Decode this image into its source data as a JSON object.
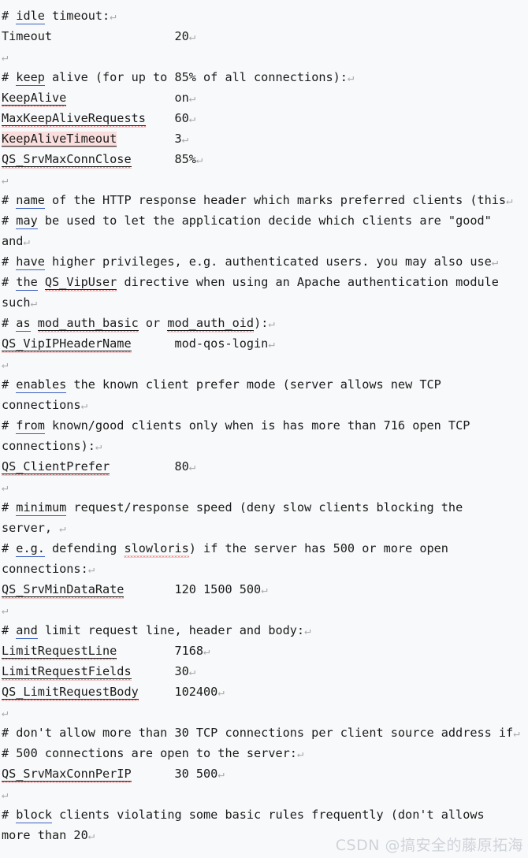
{
  "document": {
    "background_color": "#f8f9fa",
    "text_color": "#1b1b1b",
    "link_underline_color": "#3c5fbf",
    "spellcheck_squiggle_color": "#e03131",
    "highlight_color": "#f9dedd",
    "cr_mark_color": "#a6a9ad",
    "cr_mark": "↵"
  },
  "watermark": {
    "text": "CSDN @搞安全的藤原拓海"
  },
  "lines": [
    {
      "id": "l00",
      "type": "blank-clipped",
      "segments": [
        {
          "t": "cr",
          "text": "↵"
        }
      ]
    },
    {
      "id": "l01",
      "type": "comment",
      "segments": [
        {
          "t": "plain",
          "text": "# "
        },
        {
          "t": "kw",
          "text": "idle"
        },
        {
          "t": "plain",
          "text": " timeout:"
        },
        {
          "t": "cr",
          "text": "↵"
        }
      ]
    },
    {
      "id": "l02",
      "type": "directive",
      "segments": [
        {
          "t": "plain",
          "text": "Timeout"
        },
        {
          "t": "plain",
          "text": "                 20"
        },
        {
          "t": "cr",
          "text": "↵"
        }
      ]
    },
    {
      "id": "l03",
      "type": "blank",
      "segments": [
        {
          "t": "cr",
          "text": "↵"
        }
      ]
    },
    {
      "id": "l04",
      "type": "comment",
      "segments": [
        {
          "t": "plain",
          "text": "# "
        },
        {
          "t": "kw",
          "text": "keep"
        },
        {
          "t": "plain",
          "text": " alive (for up to 85% of all connections):"
        },
        {
          "t": "cr",
          "text": "↵"
        }
      ]
    },
    {
      "id": "l05",
      "type": "directive",
      "segments": [
        {
          "t": "sq",
          "text": "KeepAlive"
        },
        {
          "t": "plain",
          "text": "               on"
        },
        {
          "t": "cr",
          "text": "↵"
        }
      ]
    },
    {
      "id": "l06",
      "type": "directive",
      "segments": [
        {
          "t": "sq",
          "text": "MaxKeepAliveRequests"
        },
        {
          "t": "plain",
          "text": "    60"
        },
        {
          "t": "cr",
          "text": "↵"
        }
      ]
    },
    {
      "id": "l07",
      "type": "directive",
      "segments": [
        {
          "t": "sq-hl",
          "text": "KeepAliveTimeout"
        },
        {
          "t": "plain",
          "text": "        3"
        },
        {
          "t": "cr",
          "text": "↵"
        }
      ]
    },
    {
      "id": "l08",
      "type": "directive",
      "segments": [
        {
          "t": "sq",
          "text": "QS_SrvMaxConnClose"
        },
        {
          "t": "plain",
          "text": "      85%"
        },
        {
          "t": "cr",
          "text": "↵"
        }
      ]
    },
    {
      "id": "l09",
      "type": "blank",
      "segments": [
        {
          "t": "cr",
          "text": "↵"
        }
      ]
    },
    {
      "id": "l10",
      "type": "comment",
      "segments": [
        {
          "t": "plain",
          "text": "# "
        },
        {
          "t": "kw",
          "text": "name"
        },
        {
          "t": "plain",
          "text": " of the HTTP response header which marks preferred clients (this"
        },
        {
          "t": "cr",
          "text": "↵"
        }
      ]
    },
    {
      "id": "l11",
      "type": "comment",
      "segments": [
        {
          "t": "plain",
          "text": "# "
        },
        {
          "t": "kw",
          "text": "may"
        },
        {
          "t": "plain",
          "text": " be used to let the application decide which clients are \"good\""
        }
      ]
    },
    {
      "id": "l12",
      "type": "comment-wrap",
      "segments": [
        {
          "t": "plain",
          "text": "and"
        },
        {
          "t": "cr",
          "text": "↵"
        }
      ]
    },
    {
      "id": "l13",
      "type": "comment",
      "segments": [
        {
          "t": "plain",
          "text": "# "
        },
        {
          "t": "kw",
          "text": "have"
        },
        {
          "t": "plain",
          "text": " higher privileges, e.g. authenticated users. you may also use"
        },
        {
          "t": "cr",
          "text": "↵"
        }
      ]
    },
    {
      "id": "l14",
      "type": "comment",
      "segments": [
        {
          "t": "plain",
          "text": "# "
        },
        {
          "t": "kw",
          "text": "the"
        },
        {
          "t": "plain",
          "text": " "
        },
        {
          "t": "sq",
          "text": "QS_VipUser"
        },
        {
          "t": "plain",
          "text": " directive when using an Apache authentication module"
        }
      ]
    },
    {
      "id": "l15",
      "type": "comment-wrap",
      "segments": [
        {
          "t": "plain",
          "text": "such"
        },
        {
          "t": "cr",
          "text": "↵"
        }
      ]
    },
    {
      "id": "l16",
      "type": "comment",
      "segments": [
        {
          "t": "plain",
          "text": "# "
        },
        {
          "t": "kw",
          "text": "as"
        },
        {
          "t": "plain",
          "text": " "
        },
        {
          "t": "sq",
          "text": "mod_auth_basic"
        },
        {
          "t": "plain",
          "text": " or "
        },
        {
          "t": "sq",
          "text": "mod_auth_oid"
        },
        {
          "t": "plain",
          "text": "):"
        },
        {
          "t": "cr",
          "text": "↵"
        }
      ]
    },
    {
      "id": "l17",
      "type": "directive",
      "segments": [
        {
          "t": "sq",
          "text": "QS_VipIPHeaderName"
        },
        {
          "t": "plain",
          "text": "      mod-qos-login"
        },
        {
          "t": "cr",
          "text": "↵"
        }
      ]
    },
    {
      "id": "l18",
      "type": "blank",
      "segments": [
        {
          "t": "cr",
          "text": "↵"
        }
      ]
    },
    {
      "id": "l19",
      "type": "comment",
      "segments": [
        {
          "t": "plain",
          "text": "# "
        },
        {
          "t": "kw",
          "text": "enables"
        },
        {
          "t": "plain",
          "text": " the known client prefer mode (server allows new TCP"
        }
      ]
    },
    {
      "id": "l20",
      "type": "comment-wrap",
      "segments": [
        {
          "t": "plain",
          "text": "connections"
        },
        {
          "t": "cr",
          "text": "↵"
        }
      ]
    },
    {
      "id": "l21",
      "type": "comment",
      "segments": [
        {
          "t": "plain",
          "text": "# "
        },
        {
          "t": "kw",
          "text": "from"
        },
        {
          "t": "plain",
          "text": " known/good clients only when is has more than 716 open TCP"
        }
      ]
    },
    {
      "id": "l22",
      "type": "comment-wrap",
      "segments": [
        {
          "t": "plain",
          "text": "connections):"
        },
        {
          "t": "cr",
          "text": "↵"
        }
      ]
    },
    {
      "id": "l23",
      "type": "directive",
      "segments": [
        {
          "t": "sq",
          "text": "QS_ClientPrefer"
        },
        {
          "t": "plain",
          "text": "         80"
        },
        {
          "t": "cr",
          "text": "↵"
        }
      ]
    },
    {
      "id": "l24",
      "type": "blank",
      "segments": [
        {
          "t": "cr",
          "text": "↵"
        }
      ]
    },
    {
      "id": "l25",
      "type": "comment",
      "segments": [
        {
          "t": "plain",
          "text": "# "
        },
        {
          "t": "kw",
          "text": "minimum"
        },
        {
          "t": "plain",
          "text": " request/response speed (deny slow clients blocking the"
        }
      ]
    },
    {
      "id": "l26",
      "type": "comment-wrap",
      "segments": [
        {
          "t": "plain",
          "text": "server, "
        },
        {
          "t": "cr",
          "text": "↵"
        }
      ]
    },
    {
      "id": "l27",
      "type": "comment",
      "segments": [
        {
          "t": "plain",
          "text": "# "
        },
        {
          "t": "kw",
          "text": "e.g."
        },
        {
          "t": "plain",
          "text": " defending "
        },
        {
          "t": "sq-plain",
          "text": "slowloris"
        },
        {
          "t": "plain",
          "text": ") if the server has 500 or more open"
        }
      ]
    },
    {
      "id": "l28",
      "type": "comment-wrap",
      "segments": [
        {
          "t": "plain",
          "text": "connections:"
        },
        {
          "t": "cr",
          "text": "↵"
        }
      ]
    },
    {
      "id": "l29",
      "type": "directive",
      "segments": [
        {
          "t": "sq",
          "text": "QS_SrvMinDataRate"
        },
        {
          "t": "plain",
          "text": "       120 1500 500"
        },
        {
          "t": "cr",
          "text": "↵"
        }
      ]
    },
    {
      "id": "l30",
      "type": "blank",
      "segments": [
        {
          "t": "cr",
          "text": "↵"
        }
      ]
    },
    {
      "id": "l31",
      "type": "comment",
      "segments": [
        {
          "t": "plain",
          "text": "# "
        },
        {
          "t": "kw",
          "text": "and"
        },
        {
          "t": "plain",
          "text": " limit request line, header and body:"
        },
        {
          "t": "cr",
          "text": "↵"
        }
      ]
    },
    {
      "id": "l32",
      "type": "directive",
      "segments": [
        {
          "t": "sq",
          "text": "LimitRequestLine"
        },
        {
          "t": "plain",
          "text": "        7168"
        },
        {
          "t": "cr",
          "text": "↵"
        }
      ]
    },
    {
      "id": "l33",
      "type": "directive",
      "segments": [
        {
          "t": "sq",
          "text": "LimitRequestFields"
        },
        {
          "t": "plain",
          "text": "      30"
        },
        {
          "t": "cr",
          "text": "↵"
        }
      ]
    },
    {
      "id": "l34",
      "type": "directive",
      "segments": [
        {
          "t": "sq",
          "text": "QS_LimitRequestBody"
        },
        {
          "t": "plain",
          "text": "     102400"
        },
        {
          "t": "cr",
          "text": "↵"
        }
      ]
    },
    {
      "id": "l35",
      "type": "blank",
      "segments": [
        {
          "t": "cr",
          "text": "↵"
        }
      ]
    },
    {
      "id": "l36",
      "type": "comment",
      "segments": [
        {
          "t": "plain",
          "text": "# don't allow more than 30 TCP connections per client source address if"
        },
        {
          "t": "cr",
          "text": "↵"
        }
      ]
    },
    {
      "id": "l37",
      "type": "comment",
      "segments": [
        {
          "t": "plain",
          "text": "# 500 connections are open to the server:"
        },
        {
          "t": "cr",
          "text": "↵"
        }
      ]
    },
    {
      "id": "l38",
      "type": "directive",
      "segments": [
        {
          "t": "sq",
          "text": "QS_SrvMaxConnPerIP"
        },
        {
          "t": "plain",
          "text": "      30 500"
        },
        {
          "t": "cr",
          "text": "↵"
        }
      ]
    },
    {
      "id": "l39",
      "type": "blank",
      "segments": [
        {
          "t": "cr",
          "text": "↵"
        }
      ]
    },
    {
      "id": "l40",
      "type": "comment",
      "segments": [
        {
          "t": "plain",
          "text": "# "
        },
        {
          "t": "kw",
          "text": "block"
        },
        {
          "t": "plain",
          "text": " clients violating some basic rules frequently (don't allows"
        }
      ]
    },
    {
      "id": "l41",
      "type": "comment-wrap",
      "segments": [
        {
          "t": "plain",
          "text": "more than 20"
        },
        {
          "t": "cr",
          "text": "↵"
        }
      ]
    }
  ]
}
